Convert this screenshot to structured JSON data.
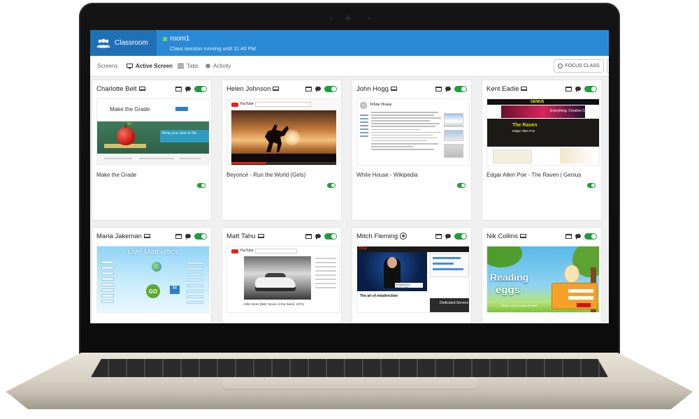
{
  "app": {
    "brand": "Classroom",
    "room_name": "room1",
    "session_status": "Class session running until 11:40 PM",
    "accent_color": "#2b8ad6",
    "brand_color": "#1f71b6",
    "toggle_color": "#1e9d3c"
  },
  "tabs": [
    {
      "label": "Screens",
      "icon": "none",
      "active": false
    },
    {
      "label": "Active Screen",
      "icon": "monitor-icon",
      "active": true
    },
    {
      "label": "Tabs",
      "icon": "list-icon",
      "active": false
    },
    {
      "label": "Activity",
      "icon": "dot-icon",
      "active": false
    }
  ],
  "toolbar": {
    "focus_label": "FOCUS CLASS"
  },
  "students": [
    {
      "name": "Charlotte Belt",
      "device": "laptop-icon",
      "caption": "Make the Grade",
      "thumb": {
        "title": "Make the Grade",
        "note": "Bring your class to life."
      }
    },
    {
      "name": "Helen Johnson",
      "device": "laptop-icon",
      "caption": "Beyoncé - Run the World (Girls)",
      "thumb": {
        "site": "YouTube"
      }
    },
    {
      "name": "John Hogg",
      "device": "laptop-icon",
      "caption": "White House - Wikipedia",
      "thumb": {
        "title": "White House"
      }
    },
    {
      "name": "Kent Eadie",
      "device": "laptop-icon",
      "caption": "Edgar Allen Poe - The Raven | Genius",
      "thumb": {
        "site": "GENIUS",
        "banner": "Everything. Creative Cloud.",
        "heading": "The Raven",
        "author": "Edgar Allen Poe"
      }
    },
    {
      "name": "Maria Jakeman",
      "device": "laptop-icon",
      "caption": "",
      "thumb": {
        "title": "Live Mathletics",
        "go": "GO",
        "m": "M"
      }
    },
    {
      "name": "Matt Tahu",
      "device": "laptop-icon",
      "caption": "",
      "thumb": {
        "site": "YouTube",
        "video_caption": "Killer Bees (BBC Movie of the Week, 1974)"
      }
    },
    {
      "name": "Mitch Fleming",
      "device": "chrome-icon",
      "caption": "",
      "thumb": {
        "site": "TED",
        "tagline": "EDINBURGH SCOTLAND",
        "headline": "The art of misdirection",
        "ad": "Dedicated Servers"
      }
    },
    {
      "name": "Nik Collins",
      "device": "laptop-icon",
      "caption": "",
      "thumb": {
        "title": "Reading",
        "title2": "eggs",
        "note": "Where children learn to read!"
      }
    }
  ]
}
